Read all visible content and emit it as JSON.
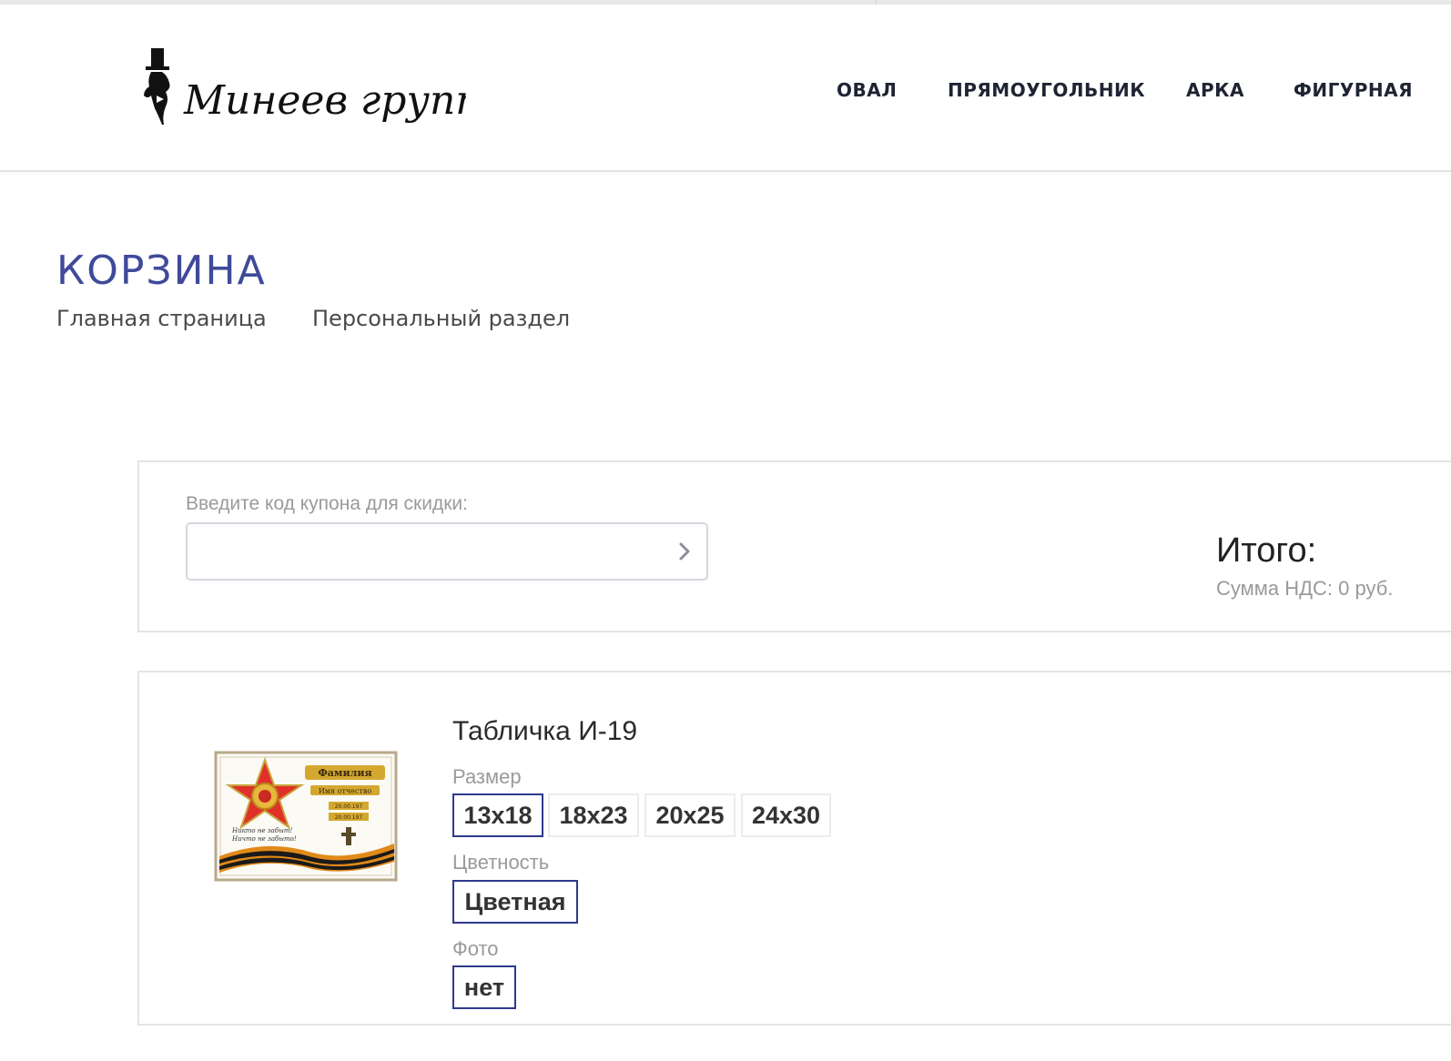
{
  "header": {
    "logo_text": "Минеев групп",
    "nav": [
      "ОВАЛ",
      "ПРЯМОУГОЛЬНИК",
      "АРКА",
      "ФИГУРНАЯ"
    ]
  },
  "page": {
    "title": "КОРЗИНА",
    "breadcrumbs": [
      "Главная страница",
      "Персональный раздел"
    ]
  },
  "coupon": {
    "label": "Введите код купона для скидки:",
    "value": "",
    "placeholder": ""
  },
  "totals": {
    "total_label": "Итого:",
    "vat_label": "Сумма НДС: 0 руб."
  },
  "product": {
    "title": "Табличка И-19",
    "properties": [
      {
        "label": "Размер",
        "options": [
          "13x18",
          "18x23",
          "20x25",
          "24x30"
        ],
        "selected": "13x18"
      },
      {
        "label": "Цветность",
        "options": [
          "Цветная"
        ],
        "selected": "Цветная"
      },
      {
        "label": "Фото",
        "options": [
          "нет"
        ],
        "selected": "нет"
      }
    ],
    "image": {
      "heading": "Фамилия",
      "subheading": "Имя отчество",
      "dates": [
        "20.00.197",
        "20.00.197"
      ],
      "motto": [
        "Никто не забыт!",
        "Ничто не забыто!"
      ]
    }
  },
  "colors": {
    "accent": "#3f4a9a",
    "selected_border": "#2d3a8c",
    "border": "#e4e4e4",
    "muted_text": "#9a9a9a"
  }
}
